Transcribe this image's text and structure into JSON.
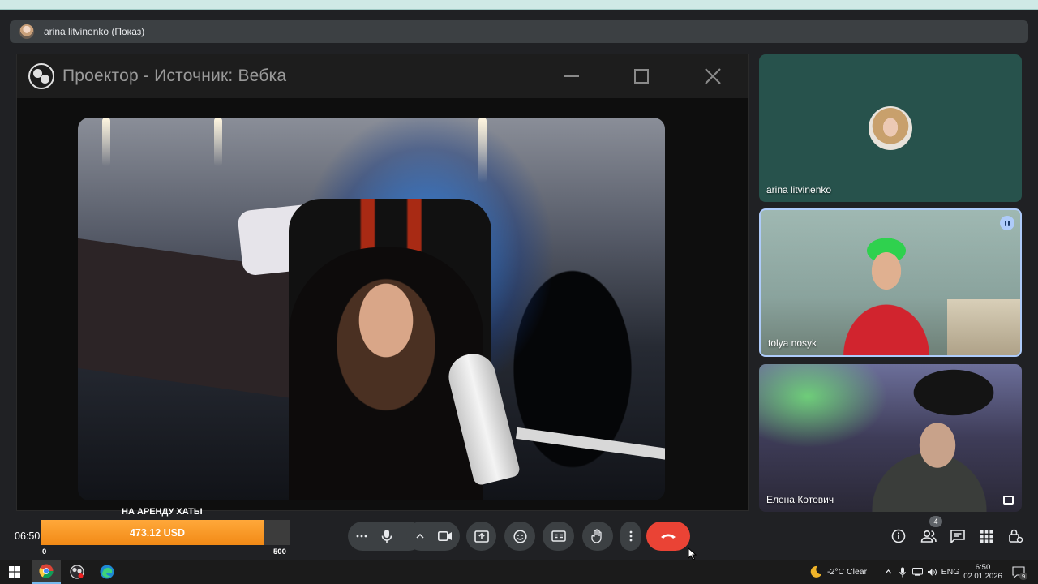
{
  "presenter": {
    "label": "arina litvinenko (Показ)"
  },
  "obs_window": {
    "title": "Проектор - Источник: Вебка",
    "controls": [
      "minimize",
      "maximize",
      "close"
    ]
  },
  "participants": [
    {
      "name": "arina litvinenko",
      "speaking": false
    },
    {
      "name": "tolya nosyk",
      "speaking": true
    },
    {
      "name": "Елена Котович",
      "speaking": false
    }
  ],
  "overlay": {
    "time": "06:50",
    "goal_label": "НА АРЕНДУ ХАТЫ",
    "goal_amount": "473.12 USD",
    "goal_current": 473.12,
    "goal_min": "0",
    "goal_max": "500",
    "goal_fill_color": "#f28a16"
  },
  "controls": {
    "buttons": [
      "more-options-icon",
      "microphone-icon",
      "chevron-up-icon",
      "camera-icon",
      "present-screen-icon",
      "emoji-icon",
      "captions-icon",
      "raise-hand-icon",
      "more-vert-icon",
      "end-call-icon"
    ],
    "end_call_color": "#ea4335",
    "people_count": "4",
    "right_icons": [
      "info-icon",
      "people-icon",
      "chat-icon",
      "apps-icon",
      "host-controls-icon"
    ]
  },
  "taskbar": {
    "weather": "-2°C  Clear",
    "language": "ENG",
    "time": "6:50",
    "date": "02.01.2026",
    "notifications": "9"
  }
}
